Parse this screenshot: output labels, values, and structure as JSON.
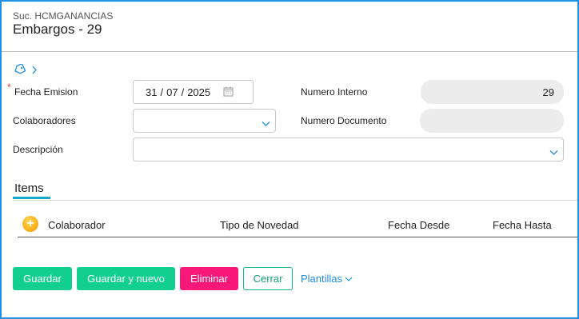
{
  "header": {
    "branch": "Suc. HCMGANANCIAS",
    "title": "Embargos - 29"
  },
  "form": {
    "fecha_emision": {
      "label": "Fecha Emision",
      "required_mark": "*",
      "day": "31",
      "month": "07",
      "year": "2025",
      "sep": "/"
    },
    "colaboradores": {
      "label": "Colaboradores",
      "value": ""
    },
    "descripcion": {
      "label": "Descripción",
      "value": ""
    },
    "numero_interno": {
      "label": "Numero Interno",
      "value": "29"
    },
    "numero_documento": {
      "label": "Numero Documento",
      "value": ""
    }
  },
  "items": {
    "tab_label": "Items",
    "columns": [
      "Colaborador",
      "Tipo de Novedad",
      "Fecha Desde",
      "Fecha Hasta"
    ],
    "add_symbol": "+"
  },
  "actions": {
    "guardar": "Guardar",
    "guardar_nuevo": "Guardar y nuevo",
    "eliminar": "Eliminar",
    "cerrar": "Cerrar",
    "plantillas": "Plantillas"
  },
  "colors": {
    "frame": "#1e90e8",
    "primary": "#12cf90",
    "danger": "#f7187a",
    "accent": "#17a9c9",
    "link": "#1d8fe0"
  },
  "icons": [
    "tag-icon",
    "chevron-right-icon",
    "calendar-icon",
    "chevron-down-icon",
    "add-circle-icon"
  ]
}
